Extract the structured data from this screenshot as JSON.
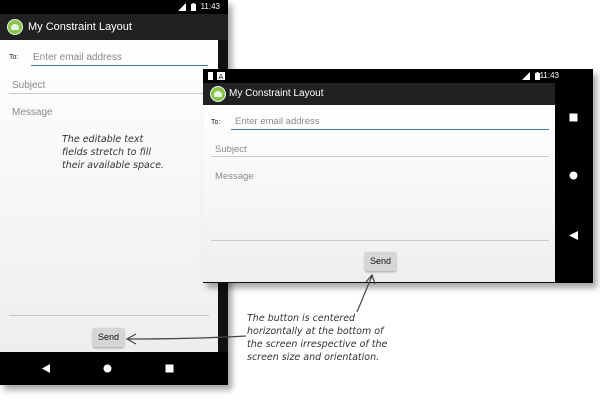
{
  "status": {
    "time": "11:43"
  },
  "app": {
    "title": "My Constraint Layout",
    "to_label": "To:",
    "email_placeholder": "Enter email address",
    "subject_placeholder": "Subject",
    "message_placeholder": "Message",
    "send_label": "Send"
  },
  "annotations": {
    "fields_note": [
      "The editable text",
      "fields stretch to fill",
      "their available space."
    ],
    "button_note": [
      "The button is centered",
      "horizontally at the bottom of",
      "the screen irrespective of the",
      "screen size and orientation."
    ]
  },
  "colors": {
    "accent": "#3d7ab8",
    "app_bar": "#212121",
    "android_green": "#8bc34a"
  }
}
